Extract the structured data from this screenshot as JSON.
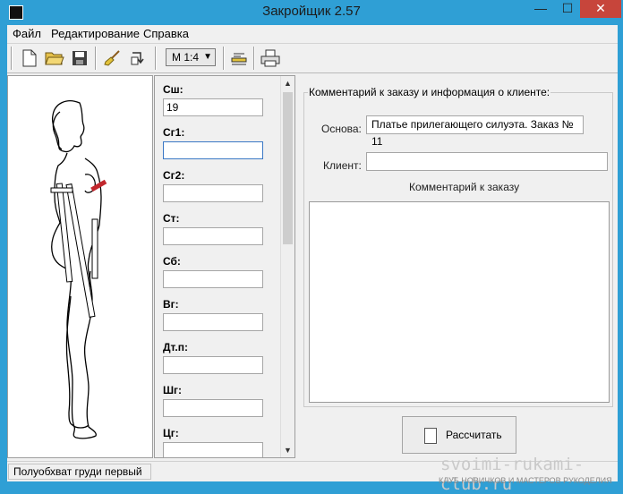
{
  "window": {
    "title": "Закройщик 2.57",
    "minimize": "—",
    "maximize": "☐",
    "close": "✕"
  },
  "menu": [
    {
      "label": "Файл"
    },
    {
      "label": "Редактирование"
    },
    {
      "label": "Справка"
    }
  ],
  "toolbar": {
    "scale": "M 1:4"
  },
  "fields": [
    {
      "label": "Сш:",
      "value": "19"
    },
    {
      "label": "Сг1:",
      "value": ""
    },
    {
      "label": "Сг2:",
      "value": ""
    },
    {
      "label": "Ст:",
      "value": ""
    },
    {
      "label": "Сб:",
      "value": ""
    },
    {
      "label": "Вг:",
      "value": ""
    },
    {
      "label": "Дт.п:",
      "value": ""
    },
    {
      "label": "Шг:",
      "value": ""
    },
    {
      "label": "Цг:",
      "value": ""
    }
  ],
  "client_info": {
    "group_title": "Комментарий к заказу и информация о клиенте:",
    "base_label": "Основа:",
    "base_value": "Платье прилегающего силуэта. Заказ № 11",
    "client_label": "Клиент:",
    "client_value": "",
    "comment_label": "Комментарий к заказу",
    "comment_value": ""
  },
  "calculate_label": "Рассчитать",
  "status_text": "Полуобхват груди первый",
  "watermark": {
    "site": "svoimi-rukami-club.ru",
    "tagline": "КЛУБ НОВИЧКОВ И МАСТЕРОВ РУКОДЕЛИЯ"
  }
}
